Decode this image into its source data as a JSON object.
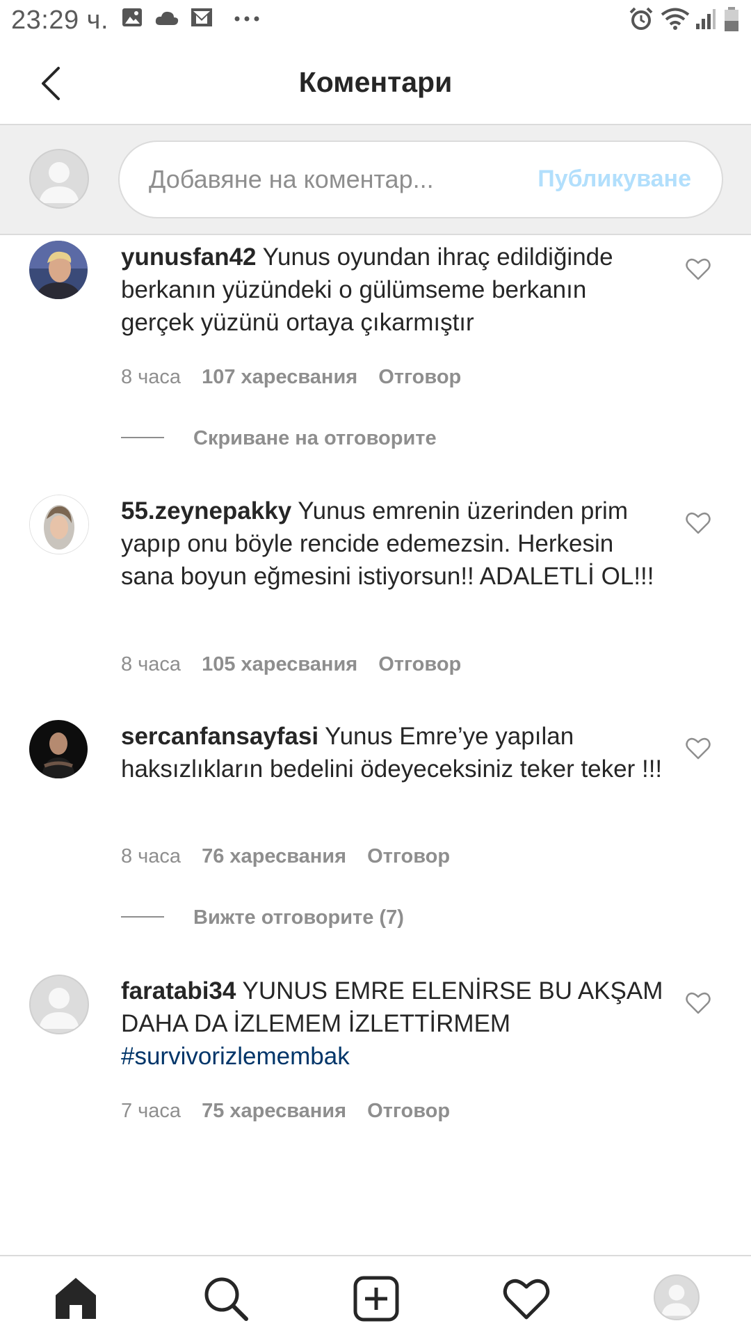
{
  "status_bar": {
    "time": "23:29 ч.",
    "icons": [
      "gallery-icon",
      "cloud-icon",
      "mail-icon",
      "more-dots-icon",
      "alarm-icon",
      "wifi-icon",
      "signal-icon",
      "battery-icon"
    ]
  },
  "header": {
    "title": "Коментари",
    "back_icon": "chevron-left-icon"
  },
  "compose": {
    "placeholder": "Добавяне на коментар...",
    "value": "",
    "publish_label": "Публикуване",
    "publish_color": "#b2dffc"
  },
  "comments": [
    {
      "username": "yunusfan42",
      "text": "Yunus oyundan ihraç edildiğinde berkanın yüzündeki o gülümseme berkanın gerçek yüzünü ortaya çıkarmıştır",
      "time": "8 часа",
      "likes": "107 харесвания",
      "reply": "Отговор",
      "replies_toggle": "Скриване на отговорите"
    },
    {
      "username": "55.zeynepakky",
      "text": "Yunus emrenin üzerinden prim yapıp onu böyle rencide edemezsin. Herkesin sana boyun eğmesini istiyorsun!! ADALETLİ OL!!!",
      "time": "8 часа",
      "likes": "105 харесвания",
      "reply": "Отговор"
    },
    {
      "username": "sercanfansayfasi",
      "text": "Yunus Emre’ye yapılan haksızlıkların bedelini ödeyeceksiniz teker teker !!!",
      "time": "8 часа",
      "likes": "76 харесвания",
      "reply": "Отговор",
      "replies_toggle": "Вижте отговорите (7)"
    },
    {
      "username": "faratabi34",
      "text": "YUNUS EMRE ELENİRSE BU AKŞAM DAHA DA İZLEMEM İZLETTİRMEM",
      "hashtag": "#survivorizlemembak",
      "time": "7 часа",
      "likes": "75 харесвания",
      "reply": "Отговор"
    }
  ],
  "bottom_nav": [
    "home-icon",
    "search-icon",
    "add-post-icon",
    "heart-activity-icon",
    "profile-icon"
  ],
  "colors": {
    "text": "#262626",
    "secondary": "#8e8e8e",
    "hashtag": "#003569",
    "divider": "#dbdbdb"
  }
}
